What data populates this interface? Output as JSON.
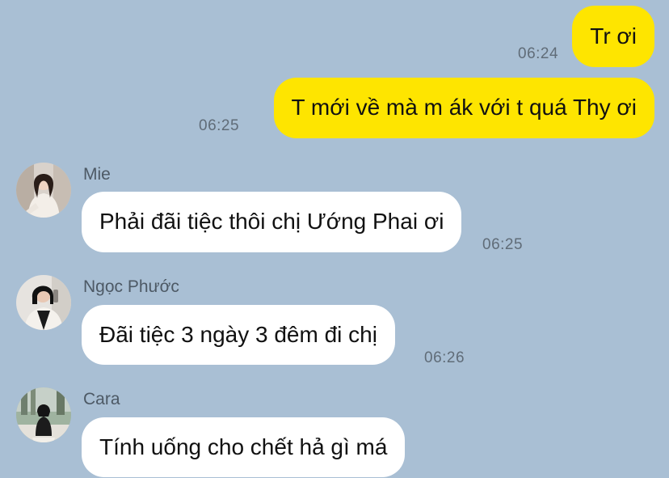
{
  "messages": [
    {
      "direction": "outgoing",
      "text": "Tr ơi",
      "time": "06:24"
    },
    {
      "direction": "outgoing",
      "text": "T mới về mà m ák với t quá Thy ơi",
      "time": "06:25"
    },
    {
      "direction": "incoming",
      "sender": "Mie",
      "avatar_icon": "avatar-mie-icon",
      "text": "Phải đãi tiệc thôi chị Ướng Phai ơi",
      "time": "06:25"
    },
    {
      "direction": "incoming",
      "sender": "Ngọc Phước",
      "avatar_icon": "avatar-ngoc-phuoc-icon",
      "text": "Đãi tiệc 3 ngày 3 đêm đi chị",
      "time": "06:26"
    },
    {
      "direction": "incoming",
      "sender": "Cara",
      "avatar_icon": "avatar-cara-icon",
      "text": "Tính uống cho chết hả gì má",
      "time": ""
    }
  ],
  "colors": {
    "background": "#a9bfd4",
    "outgoing_bubble": "#fee500",
    "incoming_bubble": "#ffffff",
    "timestamp": "#606c78",
    "sender_name": "#4d5965"
  }
}
